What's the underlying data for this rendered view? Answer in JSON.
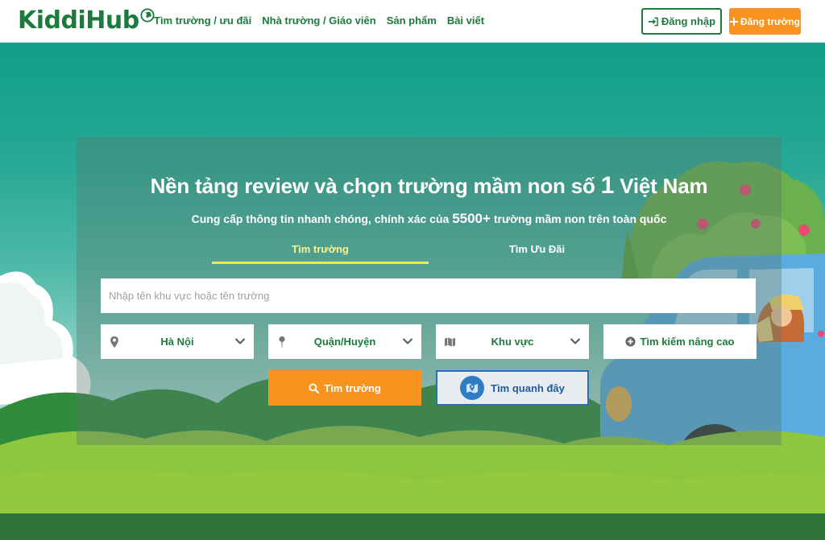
{
  "brand": {
    "name": "KiddiHub"
  },
  "nav": {
    "items": [
      {
        "label": "Tìm trường / ưu đãi"
      },
      {
        "label": "Nhà trường / Giáo viên"
      },
      {
        "label": "Sản phẩm"
      },
      {
        "label": "Bài viết"
      }
    ]
  },
  "header": {
    "login_label": "Đăng nhập",
    "register_label": "Đăng trường"
  },
  "hero": {
    "title_prefix": "Nền tảng review và chọn trường mầm non số ",
    "title_number": "1",
    "title_suffix": " Việt Nam",
    "subtitle_prefix": "Cung cấp thông tin nhanh chóng, chính xác của ",
    "subtitle_number": "5500+",
    "subtitle_suffix": " trường mầm non trên toàn quốc"
  },
  "tabs": [
    {
      "label": "Tìm trường",
      "active": true
    },
    {
      "label": "Tìm Ưu Đãi",
      "active": false
    }
  ],
  "search": {
    "placeholder": "Nhập tên khu vực hoặc tên trường",
    "value": "",
    "city": {
      "icon": "location-pin-icon",
      "value": "Hà Nội"
    },
    "district": {
      "icon": "pushpin-icon",
      "value": "Quận/Huyện"
    },
    "area": {
      "icon": "map-icon",
      "value": "Khu vực"
    },
    "advanced_label": "Tìm kiếm nâng cao",
    "submit_label": "Tìm trường",
    "nearby_label": "Tìm quanh đây"
  },
  "colors": {
    "brand_green": "#1d7a3e",
    "accent_orange": "#f7931e",
    "tab_highlight": "#f6e94a",
    "nearby_blue": "#2a6fb8"
  }
}
